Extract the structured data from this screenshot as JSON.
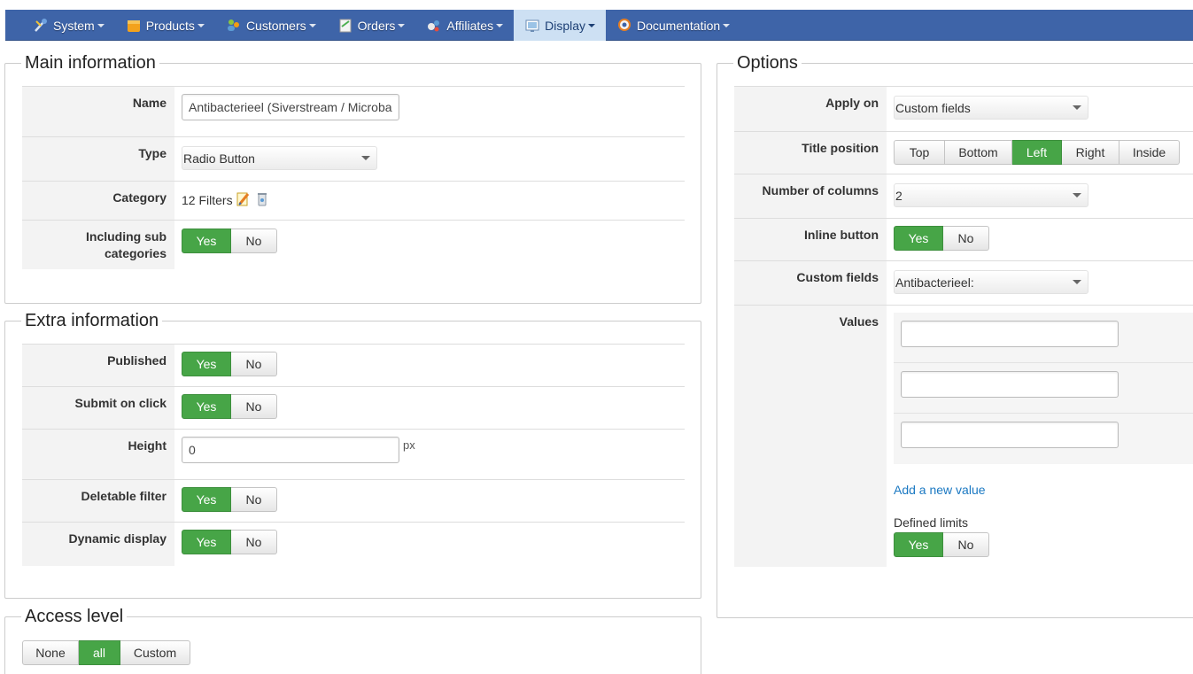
{
  "nav": {
    "items": [
      {
        "label": "System",
        "icon": "tools-icon"
      },
      {
        "label": "Products",
        "icon": "box-icon"
      },
      {
        "label": "Customers",
        "icon": "users-icon"
      },
      {
        "label": "Orders",
        "icon": "orders-icon"
      },
      {
        "label": "Affiliates",
        "icon": "affiliates-icon"
      },
      {
        "label": "Display",
        "icon": "display-icon"
      },
      {
        "label": "Documentation",
        "icon": "lifebuoy-icon"
      }
    ],
    "active": "Display"
  },
  "main_info": {
    "legend": "Main information",
    "name_label": "Name",
    "name_value": "Antibacterieel (Siverstream / Microba",
    "type_label": "Type",
    "type_value": "Radio Button",
    "category_label": "Category",
    "category_value": "12 Filters",
    "sub_label_1": "Including sub",
    "sub_label_2": "categories",
    "yes": "Yes",
    "no": "No"
  },
  "extra_info": {
    "legend": "Extra information",
    "published_label": "Published",
    "submit_label": "Submit on click",
    "height_label": "Height",
    "height_value": "0",
    "height_unit": "px",
    "deletable_label": "Deletable filter",
    "dynamic_label": "Dynamic display",
    "yes": "Yes",
    "no": "No"
  },
  "access": {
    "legend": "Access level",
    "none": "None",
    "all": "all",
    "custom": "Custom"
  },
  "options": {
    "legend": "Options",
    "apply_on_label": "Apply on",
    "apply_on_value": "Custom fields",
    "title_position_label": "Title position",
    "positions": [
      "Top",
      "Bottom",
      "Left",
      "Right",
      "Inside"
    ],
    "columns_label": "Number of columns",
    "columns_value": "2",
    "inline_label": "Inline button",
    "custom_fields_label": "Custom fields",
    "custom_fields_value": "Antibacterieel:",
    "values_label": "Values",
    "value_inputs": [
      "",
      "",
      ""
    ],
    "add_value": "Add a new value",
    "defined_limits": "Defined limits",
    "yes": "Yes",
    "no": "No"
  },
  "colors": {
    "nav_bg": "#3e64a8",
    "active_tab": "#cde0f3",
    "toggle_on": "#47a547",
    "link": "#1a78c2"
  }
}
